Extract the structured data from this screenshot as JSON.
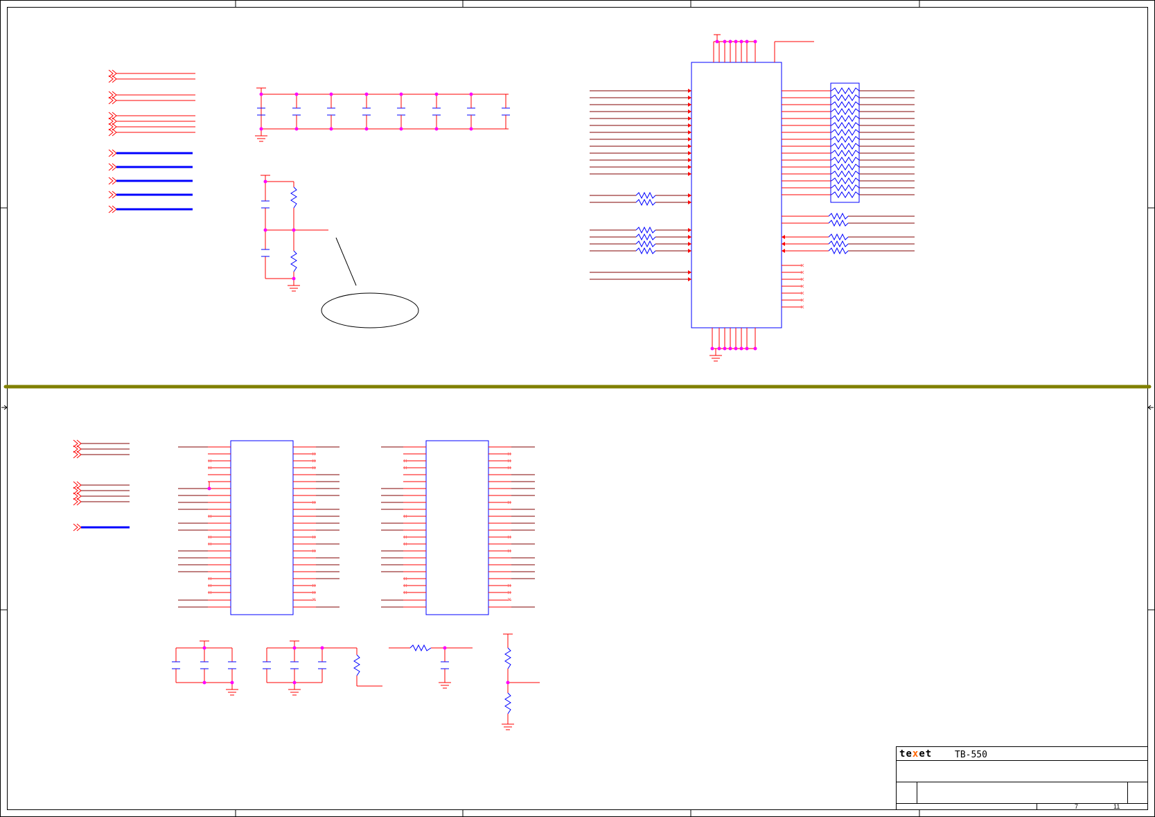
{
  "title_block": {
    "logo": "texet",
    "model": "TB-550",
    "sheet_number": "7",
    "sheet_total": "11"
  },
  "colors": {
    "wire": "#ff0000",
    "net_dark": "#800000",
    "component": "#0000ff",
    "junction": "#ff00ff",
    "divider": "#808000",
    "border": "#000000"
  },
  "icons": [
    "bus-port-icon",
    "power-symbol-icon",
    "ground-symbol-icon",
    "capacitor-icon",
    "resistor-icon",
    "no-connect-icon"
  ]
}
